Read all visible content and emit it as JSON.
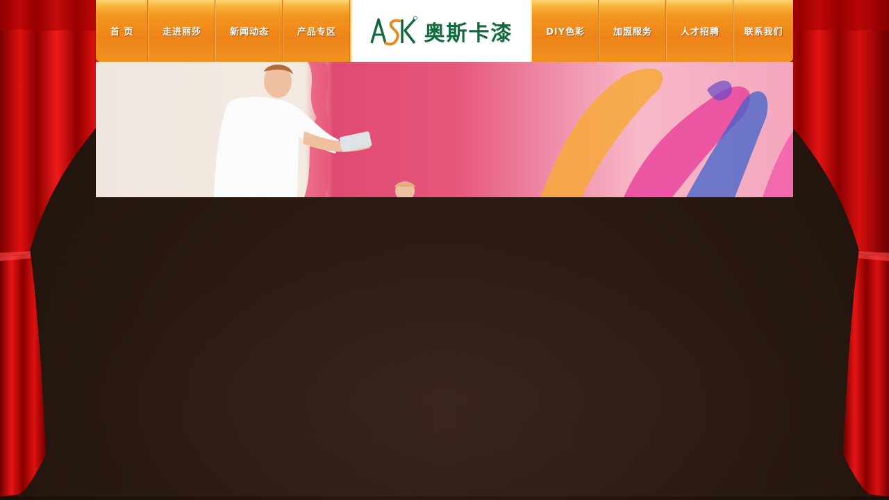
{
  "nav": {
    "left_items": [
      {
        "label": "首 页"
      },
      {
        "label": "走进丽莎"
      },
      {
        "label": "新闻动态"
      },
      {
        "label": "产品专区"
      }
    ],
    "logo": {
      "mark": "ASK",
      "registered": "®",
      "text": "奥斯卡漆"
    },
    "right_items": [
      {
        "label": "DIY色彩"
      },
      {
        "label": "加盟服务"
      },
      {
        "label": "人才招聘"
      },
      {
        "label": "联系我们"
      }
    ]
  },
  "banner": {
    "image": "painter-painting-pink-wall-banner"
  },
  "colors": {
    "nav_orange": "#ef8a1c",
    "logo_green": "#0f6a3c",
    "logo_orange": "#e8891c",
    "curtain_red": "#d00d0d",
    "stage_brown": "#2a1a12"
  }
}
